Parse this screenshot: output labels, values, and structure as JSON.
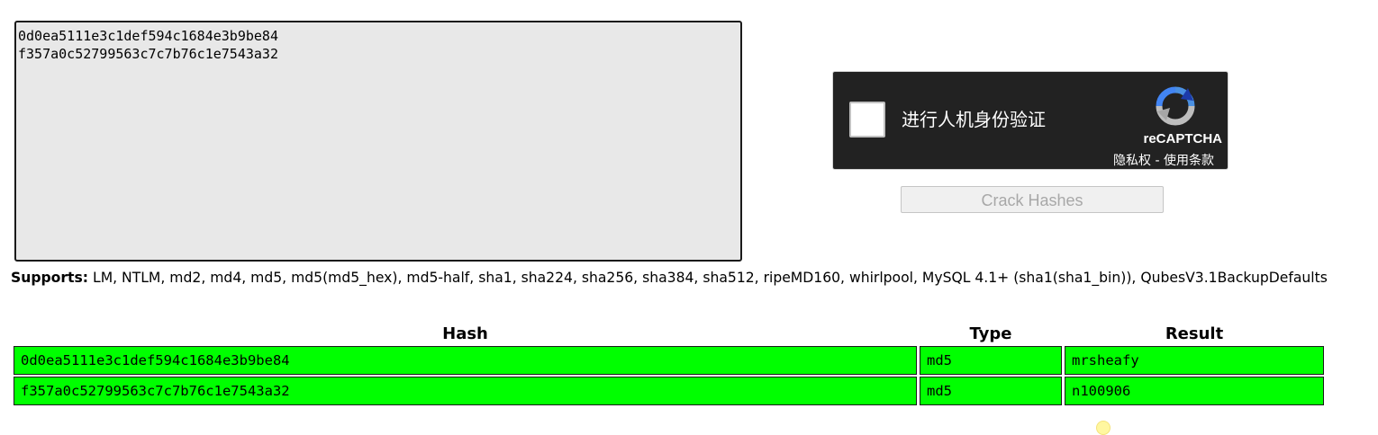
{
  "hash_input": {
    "value": "0d0ea5111e3c1def594c1684e3b9be84\nf357a0c52799563c7c7b76c1e7543a32"
  },
  "captcha": {
    "label": "进行人机身份验证",
    "brand": "reCAPTCHA",
    "privacy": "隐私权",
    "separator": " - ",
    "terms": "使用条款",
    "icon": "recaptcha-logo-icon"
  },
  "crack_button": {
    "label": "Crack Hashes"
  },
  "supports": {
    "heading": "Supports:",
    "list": " LM, NTLM, md2, md4, md5, md5(md5_hex), md5-half, sha1, sha224, sha256, sha384, sha512, ripeMD160, whirlpool, MySQL 4.1+ (sha1(sha1_bin)), QubesV3.1BackupDefaults"
  },
  "results": {
    "headers": {
      "hash": "Hash",
      "type": "Type",
      "result": "Result"
    },
    "rows": [
      {
        "hash": "0d0ea5111e3c1def594c1684e3b9be84",
        "type": "md5",
        "result": "mrsheafy"
      },
      {
        "hash": "f357a0c52799563c7c7b76c1e7543a32",
        "type": "md5",
        "result": "n100906"
      }
    ],
    "success_color": "#00ff00"
  }
}
